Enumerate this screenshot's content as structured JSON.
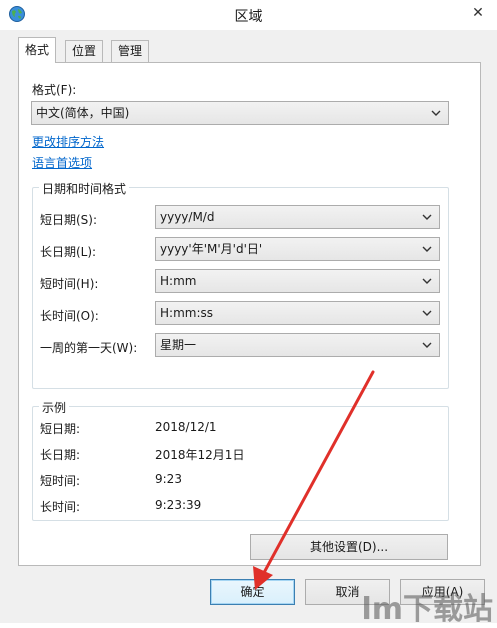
{
  "window": {
    "title": "区域",
    "close_glyph": "✕"
  },
  "tabs": [
    {
      "label": "格式",
      "active": true
    },
    {
      "label": "位置",
      "active": false
    },
    {
      "label": "管理",
      "active": false
    }
  ],
  "format": {
    "label": "格式(F):",
    "selected": "中文(简体，中国)"
  },
  "links": {
    "change_sort": "更改排序方法",
    "language_pref": "语言首选项"
  },
  "datetime_group": {
    "legend": "日期和时间格式",
    "rows": [
      {
        "label": "短日期(S):",
        "value": "yyyy/M/d"
      },
      {
        "label": "长日期(L):",
        "value": "yyyy'年'M'月'd'日'"
      },
      {
        "label": "短时间(H):",
        "value": "H:mm"
      },
      {
        "label": "长时间(O):",
        "value": "H:mm:ss"
      },
      {
        "label": "一周的第一天(W):",
        "value": "星期一"
      }
    ]
  },
  "examples": {
    "legend": "示例",
    "rows": [
      {
        "label": "短日期:",
        "value": "2018/12/1"
      },
      {
        "label": "长日期:",
        "value": "2018年12月1日"
      },
      {
        "label": "短时间:",
        "value": "9:23"
      },
      {
        "label": "长时间:",
        "value": "9:23:39"
      }
    ]
  },
  "buttons": {
    "other_settings": "其他设置(D)...",
    "ok": "确定",
    "cancel": "取消",
    "apply": "应用(A)"
  },
  "icons": {
    "app": "globe-icon",
    "dropdown": "chevron-down-icon"
  },
  "colors": {
    "link": "#0066cc",
    "arrow": "#e0302a",
    "default_button_border": "#3c7fb1"
  },
  "watermark": "lm下载站"
}
